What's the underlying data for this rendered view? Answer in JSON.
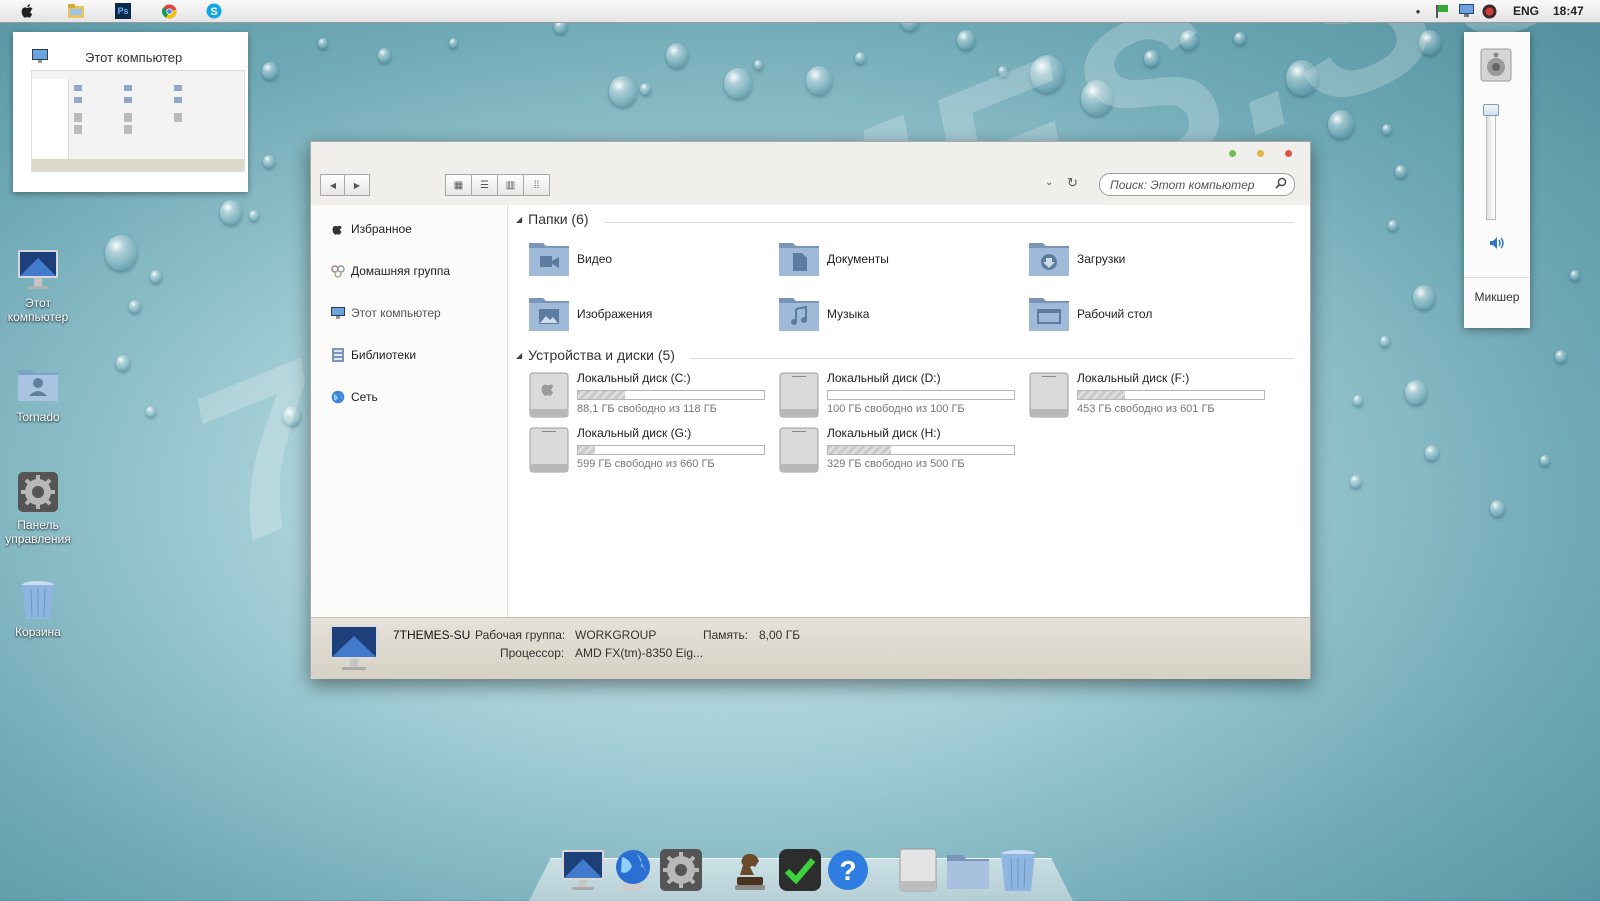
{
  "menubar": {
    "apps": [
      "apple-icon",
      "folder-icon",
      "photoshop-icon",
      "chrome-icon",
      "skype-icon"
    ],
    "photoshop_label": "Ps",
    "language": "ENG",
    "time": "18:47"
  },
  "preview": {
    "title": "Этот компьютер"
  },
  "desktop": {
    "icons": [
      {
        "label": "Этот компьютер"
      },
      {
        "label": "Tornado"
      },
      {
        "label": "Панель управления"
      },
      {
        "label": "Корзина"
      }
    ]
  },
  "window": {
    "search_placeholder": "Поиск: Этот компьютер",
    "sidebar": [
      {
        "label": "Избранное"
      },
      {
        "label": "Домашняя группа"
      },
      {
        "label": "Этот компьютер"
      },
      {
        "label": "Библиотеки"
      },
      {
        "label": "Сеть"
      }
    ],
    "folders_header": "Папки (6)",
    "folders": [
      {
        "label": "Видео"
      },
      {
        "label": "Документы"
      },
      {
        "label": "Загрузки"
      },
      {
        "label": "Изображения"
      },
      {
        "label": "Музыка"
      },
      {
        "label": "Рабочий стол"
      }
    ],
    "devices_header": "Устройства и диски (5)",
    "drives": [
      {
        "name": "Локальный диск (C:)",
        "free": "88,1 ГБ свободно из 118 ГБ",
        "used_fraction": 0.25
      },
      {
        "name": "Локальный диск (D:)",
        "free": "100 ГБ свободно из 100 ГБ",
        "used_fraction": 0.0
      },
      {
        "name": "Локальный диск (F:)",
        "free": "453 ГБ свободно из 601 ГБ",
        "used_fraction": 0.25
      },
      {
        "name": "Локальный диск (G:)",
        "free": "599 ГБ свободно из 660 ГБ",
        "used_fraction": 0.09
      },
      {
        "name": "Локальный диск (H:)",
        "free": "329 ГБ свободно из 500 ГБ",
        "used_fraction": 0.34
      }
    ],
    "details": {
      "computer_name": "7THEMES-SU",
      "workgroup_label": "Рабочая группа:",
      "workgroup_value": "WORKGROUP",
      "memory_label": "Память:",
      "memory_value": "8,00 ГБ",
      "cpu_label": "Процессор:",
      "cpu_value": "AMD FX(tm)-8350 Eig..."
    }
  },
  "volume": {
    "mixer_label": "Микшер",
    "level": 0.1
  },
  "dock": {
    "items": [
      "computer-icon",
      "network-globe-icon",
      "settings-icon",
      "chess-icon",
      "check-icon",
      "help-icon",
      "drive-icon",
      "folder-icon",
      "trash-icon"
    ]
  },
  "watermark": "7THEMES.SU"
}
